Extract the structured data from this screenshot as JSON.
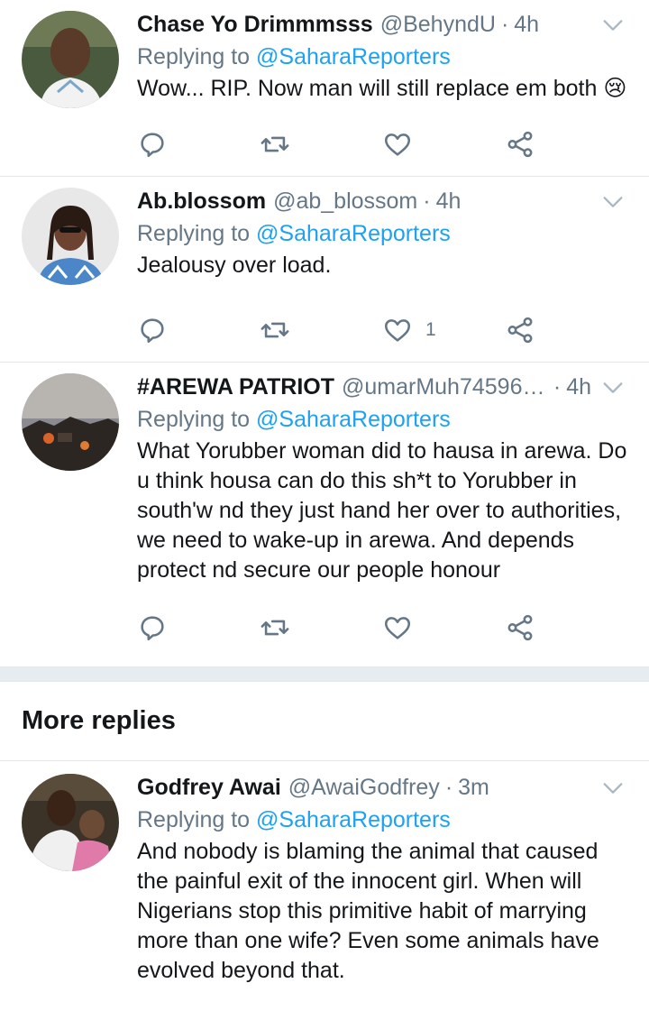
{
  "tweets": [
    {
      "name": "Chase Yo Drimmmsss",
      "handle": "@BehyndU",
      "separator": "·",
      "time": "4h",
      "replying_label": "Replying to",
      "replying_to": "@SaharaReporters",
      "text": "Wow... RIP. Now man will still replace em both 😢",
      "like_count": ""
    },
    {
      "name": "Ab.blossom",
      "handle": "@ab_blossom",
      "separator": "·",
      "time": "4h",
      "replying_label": "Replying to",
      "replying_to": "@SaharaReporters",
      "text": "Jealousy over load.",
      "like_count": "1"
    },
    {
      "name": "#AREWA PATRIOT",
      "handle": "@umarMuh745961...",
      "separator": "·",
      "time": "4h",
      "replying_label": "Replying to",
      "replying_to": "@SaharaReporters",
      "text": "What Yorubber woman did to hausa in arewa. Do u think housa can do this sh*t to Yorubber in south'w nd they just hand her over to authorities, we need to wake-up in arewa. And depends protect nd secure our people honour",
      "like_count": ""
    }
  ],
  "more_replies": {
    "heading": "More replies"
  },
  "more_tweets": [
    {
      "name": "Godfrey Awai",
      "handle": "@AwaiGodfrey",
      "separator": "·",
      "time": "3m",
      "replying_label": "Replying to",
      "replying_to": "@SaharaReporters",
      "text": "And nobody is blaming the animal that caused the painful exit of the innocent girl. When will Nigerians stop this primitive habit of marrying more than one wife? Even some animals have evolved beyond that."
    }
  ],
  "colors": {
    "accent": "#1da1f2",
    "secondary_text": "#657786",
    "primary_text": "#14171a",
    "divider": "#e1e8ed"
  },
  "icons": [
    "reply-icon",
    "retweet-icon",
    "like-icon",
    "share-icon",
    "chevron-down-icon"
  ]
}
